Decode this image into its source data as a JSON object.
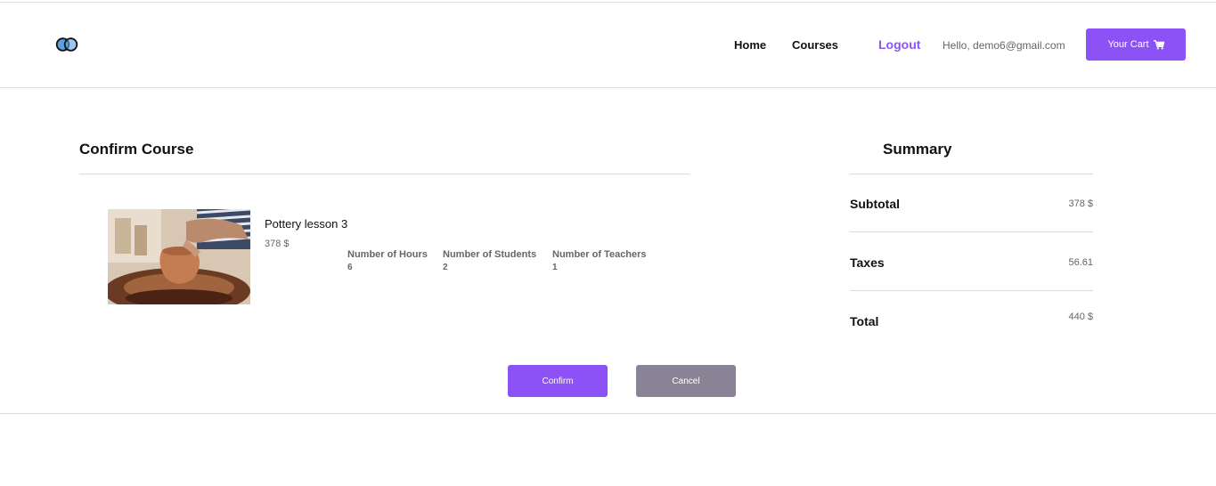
{
  "header": {
    "logo_icon": "interlocking-rings-icon",
    "nav": {
      "home": "Home",
      "courses": "Courses",
      "logout": "Logout"
    },
    "greeting": "Hello, demo6@gmail.com",
    "cart_label": "Your Cart",
    "cart_icon": "shopping-cart-icon"
  },
  "confirm": {
    "title": "Confirm Course",
    "course": {
      "name": "Pottery lesson 3",
      "price": "378 $",
      "stats": {
        "hours_label": "Number of Hours",
        "hours_value": "6",
        "students_label": "Number of Students",
        "students_value": "2",
        "teachers_label": "Number of Teachers",
        "teachers_value": "1"
      }
    }
  },
  "summary": {
    "title": "Summary",
    "subtotal_label": "Subtotal",
    "subtotal_value": "378 $",
    "taxes_label": "Taxes",
    "taxes_value": "56.61",
    "total_label": "Total",
    "total_value": "440 $"
  },
  "actions": {
    "confirm_label": "Confirm",
    "cancel_label": "Cancel"
  },
  "colors": {
    "accent": "#8c52f5",
    "cancel": "#8a8396"
  }
}
